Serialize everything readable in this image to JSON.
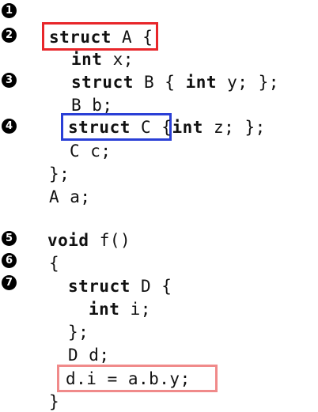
{
  "markers": [
    "1",
    "2",
    "3",
    "4",
    "5",
    "6",
    "7"
  ],
  "code": {
    "l2_kw": "struct",
    "l2_rest": " A {",
    "l3_kw": "int",
    "l3_rest": " x;",
    "l4_kw1": "struct",
    "l4_mid": " B { ",
    "l4_kw2": "int",
    "l4_rest": " y; };",
    "l5": "B b;",
    "l6_kw1": "struct",
    "l6_mid": " C {",
    "l6_kw2": "int",
    "l6_rest": " z; };",
    "l7": "C c;",
    "l8": "};",
    "l9": "A a;",
    "l10_kw": "void",
    "l10_rest": " f()",
    "l11": "{",
    "l12_kw": "struct",
    "l12_rest": " D {",
    "l13_kw": "int",
    "l13_rest": " i;",
    "l14": "};",
    "l15": "D d;",
    "l16": "d.i = a.b.y;",
    "l17": "}"
  },
  "highlights": {
    "struct_a_color": "#e8262a",
    "struct_c_color": "#2a3fd6",
    "assignment_color": "#f08a8a"
  }
}
